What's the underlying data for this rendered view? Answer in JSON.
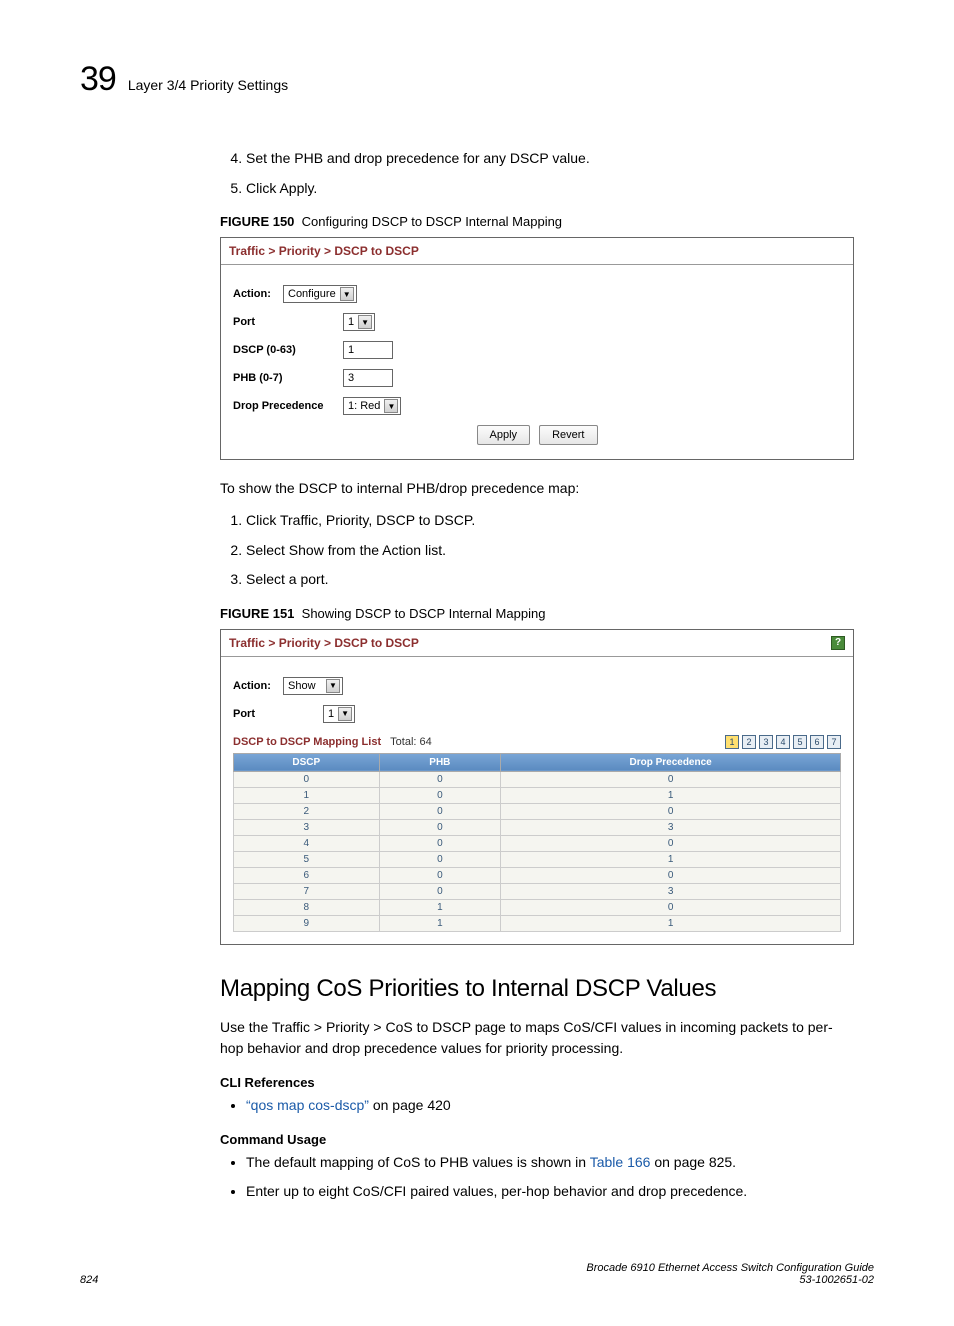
{
  "header": {
    "chapter": "39",
    "title": "Layer 3/4 Priority Settings"
  },
  "steps1": {
    "start": 4,
    "items": [
      "Set the PHB and drop precedence for any DSCP value.",
      "Click Apply."
    ]
  },
  "fig150": {
    "label": "FIGURE 150",
    "caption": "Configuring DSCP to DSCP Internal Mapping",
    "breadcrumb": "Traffic > Priority > DSCP to DSCP",
    "action_label": "Action:",
    "action_value": "Configure",
    "rows": {
      "port_label": "Port",
      "port_value": "1",
      "dscp_label": "DSCP (0-63)",
      "dscp_value": "1",
      "phb_label": "PHB (0-7)",
      "phb_value": "3",
      "drop_label": "Drop Precedence",
      "drop_value": "1: Red"
    },
    "buttons": {
      "apply": "Apply",
      "revert": "Revert"
    }
  },
  "intro2": "To show the DSCP to internal PHB/drop precedence map:",
  "steps2": {
    "items": [
      "Click Traffic, Priority, DSCP to DSCP.",
      "Select Show from the Action list.",
      "Select a port."
    ]
  },
  "fig151": {
    "label": "FIGURE 151",
    "caption": "Showing DSCP to DSCP Internal Mapping",
    "breadcrumb": "Traffic > Priority > DSCP to DSCP",
    "action_label": "Action:",
    "action_value": "Show",
    "port_label": "Port",
    "port_value": "1",
    "list_title": "DSCP to DSCP Mapping List",
    "list_total_label": "Total:",
    "list_total": "64",
    "pages": [
      "1",
      "2",
      "3",
      "4",
      "5",
      "6",
      "7"
    ],
    "columns": [
      "DSCP",
      "PHB",
      "Drop Precedence"
    ],
    "rows": [
      [
        "0",
        "0",
        "0"
      ],
      [
        "1",
        "0",
        "1"
      ],
      [
        "2",
        "0",
        "0"
      ],
      [
        "3",
        "0",
        "3"
      ],
      [
        "4",
        "0",
        "0"
      ],
      [
        "5",
        "0",
        "1"
      ],
      [
        "6",
        "0",
        "0"
      ],
      [
        "7",
        "0",
        "3"
      ],
      [
        "8",
        "1",
        "0"
      ],
      [
        "9",
        "1",
        "1"
      ]
    ]
  },
  "section": {
    "heading": "Mapping CoS Priorities to Internal DSCP Values",
    "para": "Use the Traffic > Priority > CoS to DSCP page to maps CoS/CFI values in incoming packets to per-hop behavior and drop precedence values for priority processing.",
    "cli_head": "CLI References",
    "cli_link": "“qos map cos-dscp”",
    "cli_rest": " on page 420",
    "usage_head": "Command Usage",
    "usage_items_pre": [
      "The default mapping of CoS to PHB values is shown in ",
      "Enter up to eight CoS/CFI paired values, per-hop behavior and drop precedence."
    ],
    "usage_link": "Table 166",
    "usage_rest": " on page 825."
  },
  "footer": {
    "page": "824",
    "guide": "Brocade 6910 Ethernet Access Switch Configuration Guide",
    "docnum": "53-1002651-02"
  }
}
